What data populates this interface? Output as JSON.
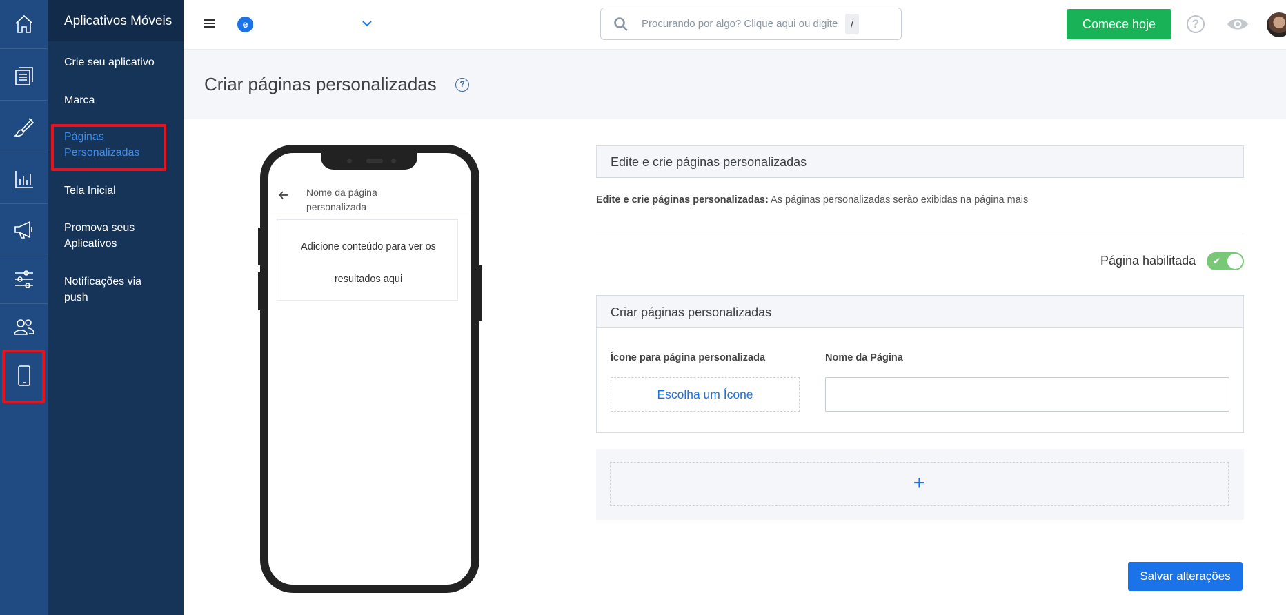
{
  "colors": {
    "rail_bg": "#1f4a82",
    "subnav_bg": "#163458",
    "accent": "#1a73e8",
    "cta_green": "#1ab256",
    "highlight_red": "#e3141e",
    "toggle_on": "#79c878"
  },
  "rail": {
    "icons": [
      "home-icon",
      "documents-icon",
      "brush-icon",
      "analytics-icon",
      "megaphone-icon",
      "sliders-icon",
      "users-icon",
      "mobile-icon"
    ],
    "active": "mobile-icon"
  },
  "subnav": {
    "title": "Aplicativos Móveis",
    "items": [
      {
        "label": "Crie seu aplicativo"
      },
      {
        "label": "Marca"
      },
      {
        "label": "Páginas Personalizadas"
      },
      {
        "label": "Tela Inicial"
      },
      {
        "label": "Promova seus Aplicativos"
      },
      {
        "label": "Notificações via push"
      }
    ],
    "active_item": "Páginas Personalizadas"
  },
  "topbar": {
    "brand_letter": "e",
    "search_placeholder": "Procurando por algo? Clique aqui ou digite",
    "search_shortcut": "/",
    "cta_label": "Comece hoje",
    "help_glyph": "?"
  },
  "page": {
    "title": "Criar páginas personalizadas",
    "help_glyph": "?"
  },
  "phone": {
    "page_name": "Nome da página personalizada",
    "placeholder": "Adicione conteúdo para ver os resultados aqui"
  },
  "panel": {
    "section_title": "Edite e crie páginas personalizadas",
    "desc_bold": "Edite e crie páginas personalizadas:",
    "desc_text": " As páginas personalizadas serão exibidas na página mais",
    "toggle_label": "Página habilitada",
    "toggle_on": true,
    "card_title": "Criar páginas personalizadas",
    "icon_field_label": "Ícone para página personalizada",
    "icon_button_label": "Escolha um Ícone",
    "name_field_label": "Nome da Página",
    "name_field_value": "",
    "add_glyph": "+",
    "save_label": "Salvar alterações"
  }
}
